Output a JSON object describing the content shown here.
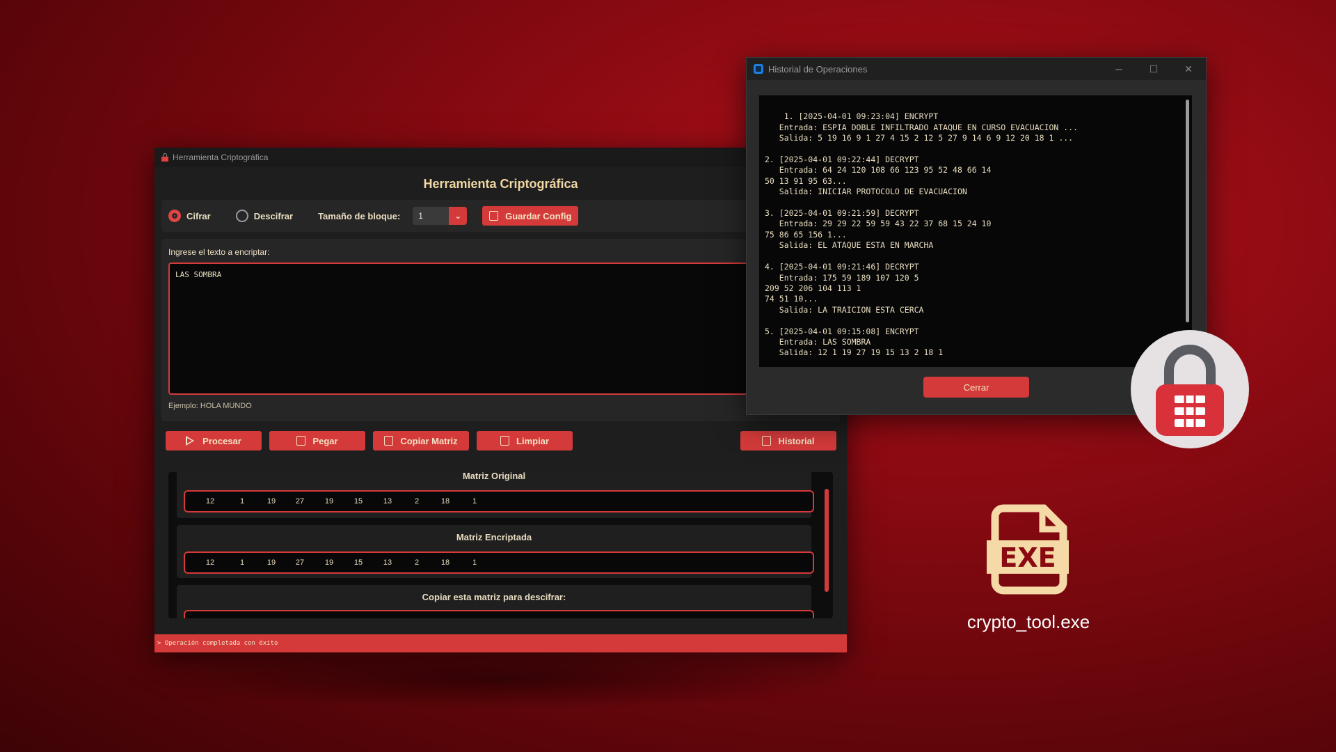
{
  "main_window": {
    "titlebar": "Herramienta Criptográfica",
    "heading": "Herramienta Criptográfica",
    "mode_encrypt": "Cifrar",
    "mode_decrypt": "Descifrar",
    "selected_mode": "Cifrar",
    "block_size_label": "Tamaño de bloque:",
    "block_size_value": "1",
    "save_config": "Guardar Config",
    "input_label": "Ingrese el texto a encriptar:",
    "input_value": "LAS SOMBRA",
    "example": "Ejemplo: HOLA MUNDO",
    "actions": {
      "process": "Procesar",
      "paste": "Pegar",
      "copy_matrix": "Copiar Matriz",
      "clear": "Limpiar",
      "history": "Historial"
    },
    "original_matrix_title": "Matriz Original",
    "original_matrix": [
      "12",
      "1",
      "19",
      "27",
      "19",
      "15",
      "13",
      "2",
      "18",
      "1"
    ],
    "encrypted_matrix_title": "Matriz Encriptada",
    "encrypted_matrix": [
      "12",
      "1",
      "19",
      "27",
      "19",
      "15",
      "13",
      "2",
      "18",
      "1"
    ],
    "copy_matrix_title": "Copiar esta matriz para descifrar:",
    "status": "> Operación completada con éxito"
  },
  "history_window": {
    "title": "Historial de Operaciones",
    "log_text": "1. [2025-04-01 09:23:04] ENCRYPT\n   Entrada: ESPIA DOBLE INFILTRADO ATAQUE EN CURSO EVACUACION ...\n   Salida: 5 19 16 9 1 27 4 15 2 12 5 27 9 14 6 9 12 20 18 1 ...\n\n2. [2025-04-01 09:22:44] DECRYPT\n   Entrada: 64 24 120 108 66 123 95 52 48 66 14\n50 13 91 95 63...\n   Salida: INICIAR PROTOCOLO DE EVACUACION\n\n3. [2025-04-01 09:21:59] DECRYPT\n   Entrada: 29 29 22 59 59 43 22 37 68 15 24 10\n75 86 65 156 1...\n   Salida: EL ATAQUE ESTA EN MARCHA\n\n4. [2025-04-01 09:21:46] DECRYPT\n   Entrada: 175 59 189 107 120 5\n209 52 206 104 113 1\n74 51 10...\n   Salida: LA TRAICION ESTA CERCA\n\n5. [2025-04-01 09:15:08] ENCRYPT\n   Entrada: LAS SOMBRA\n   Salida: 12 1 19 27 19 15 13 2 18 1",
    "close": "Cerrar",
    "minimize_glyph": "─",
    "maximize_glyph": "☐",
    "close_glyph": "✕"
  },
  "desktop": {
    "exe_badge": "EXE",
    "exe_filename": "crypto_tool.exe"
  },
  "colors": {
    "accent": "#d43a3a",
    "text": "#e8dcc0",
    "window_bg": "#1e1e1e"
  }
}
